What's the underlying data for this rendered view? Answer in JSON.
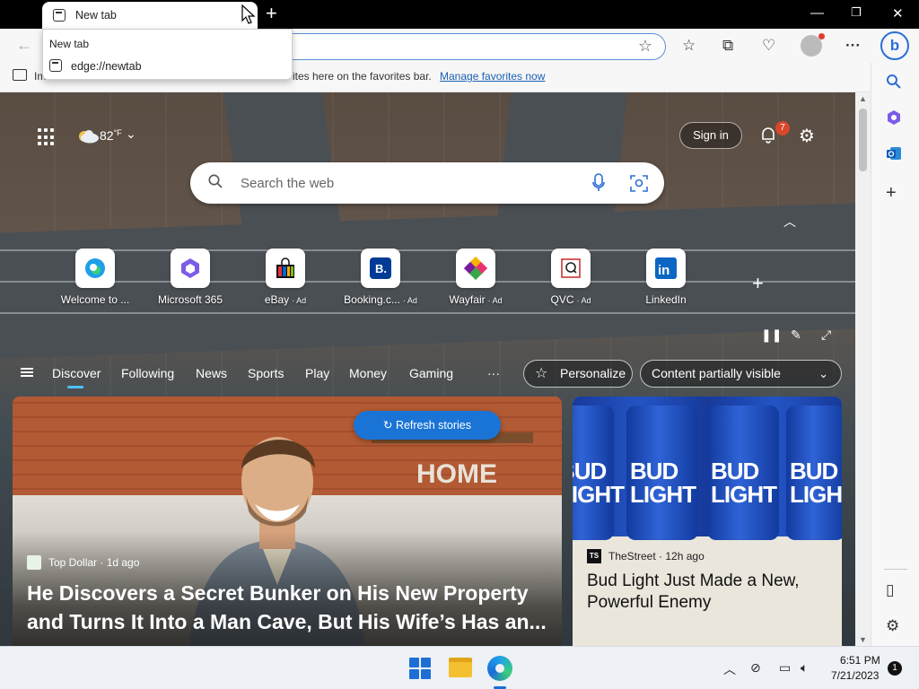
{
  "browser": {
    "tab_title": "New tab",
    "tab_hover": {
      "title": "New tab",
      "url": "edge://newtab"
    },
    "favorites_bar": {
      "message_start": "Im",
      "message_end": "ites here on the favorites bar.",
      "link": "Manage favorites now"
    }
  },
  "newtab": {
    "weather": {
      "temp": "82",
      "unit": "°F"
    },
    "sign_in": "Sign in",
    "notifications_count": "7",
    "search_placeholder": "Search the web",
    "quick_links": [
      {
        "label": "Welcome to ...",
        "ad": ""
      },
      {
        "label": "Microsoft 365",
        "ad": ""
      },
      {
        "label": "eBay",
        "ad": "Ad"
      },
      {
        "label": "Booking.c...",
        "ad": "Ad"
      },
      {
        "label": "Wayfair",
        "ad": "Ad"
      },
      {
        "label": "QVC",
        "ad": "Ad"
      },
      {
        "label": "LinkedIn",
        "ad": ""
      }
    ],
    "nav_tabs": [
      "Discover",
      "Following",
      "News",
      "Sports",
      "Play",
      "Money",
      "Gaming",
      "···"
    ],
    "personalize": "Personalize",
    "content_visibility": "Content partially visible",
    "refresh": "Refresh stories",
    "cards": [
      {
        "source": "Top Dollar",
        "age": "1d ago",
        "headline": "He Discovers a Secret Bunker on His New Property and Turns It Into a Man Cave, But His Wife’s Has an..."
      },
      {
        "source": "TheStreet",
        "age": "12h ago",
        "headline": "Bud Light Just Made a New, Powerful Enemy",
        "source_logo": "TS",
        "image_text": [
          "BUD",
          "LIGHT"
        ]
      }
    ],
    "bg_image_text": "HOME"
  },
  "taskbar": {
    "time": "6:51 PM",
    "date": "7/21/2023",
    "notification_count": "1"
  }
}
